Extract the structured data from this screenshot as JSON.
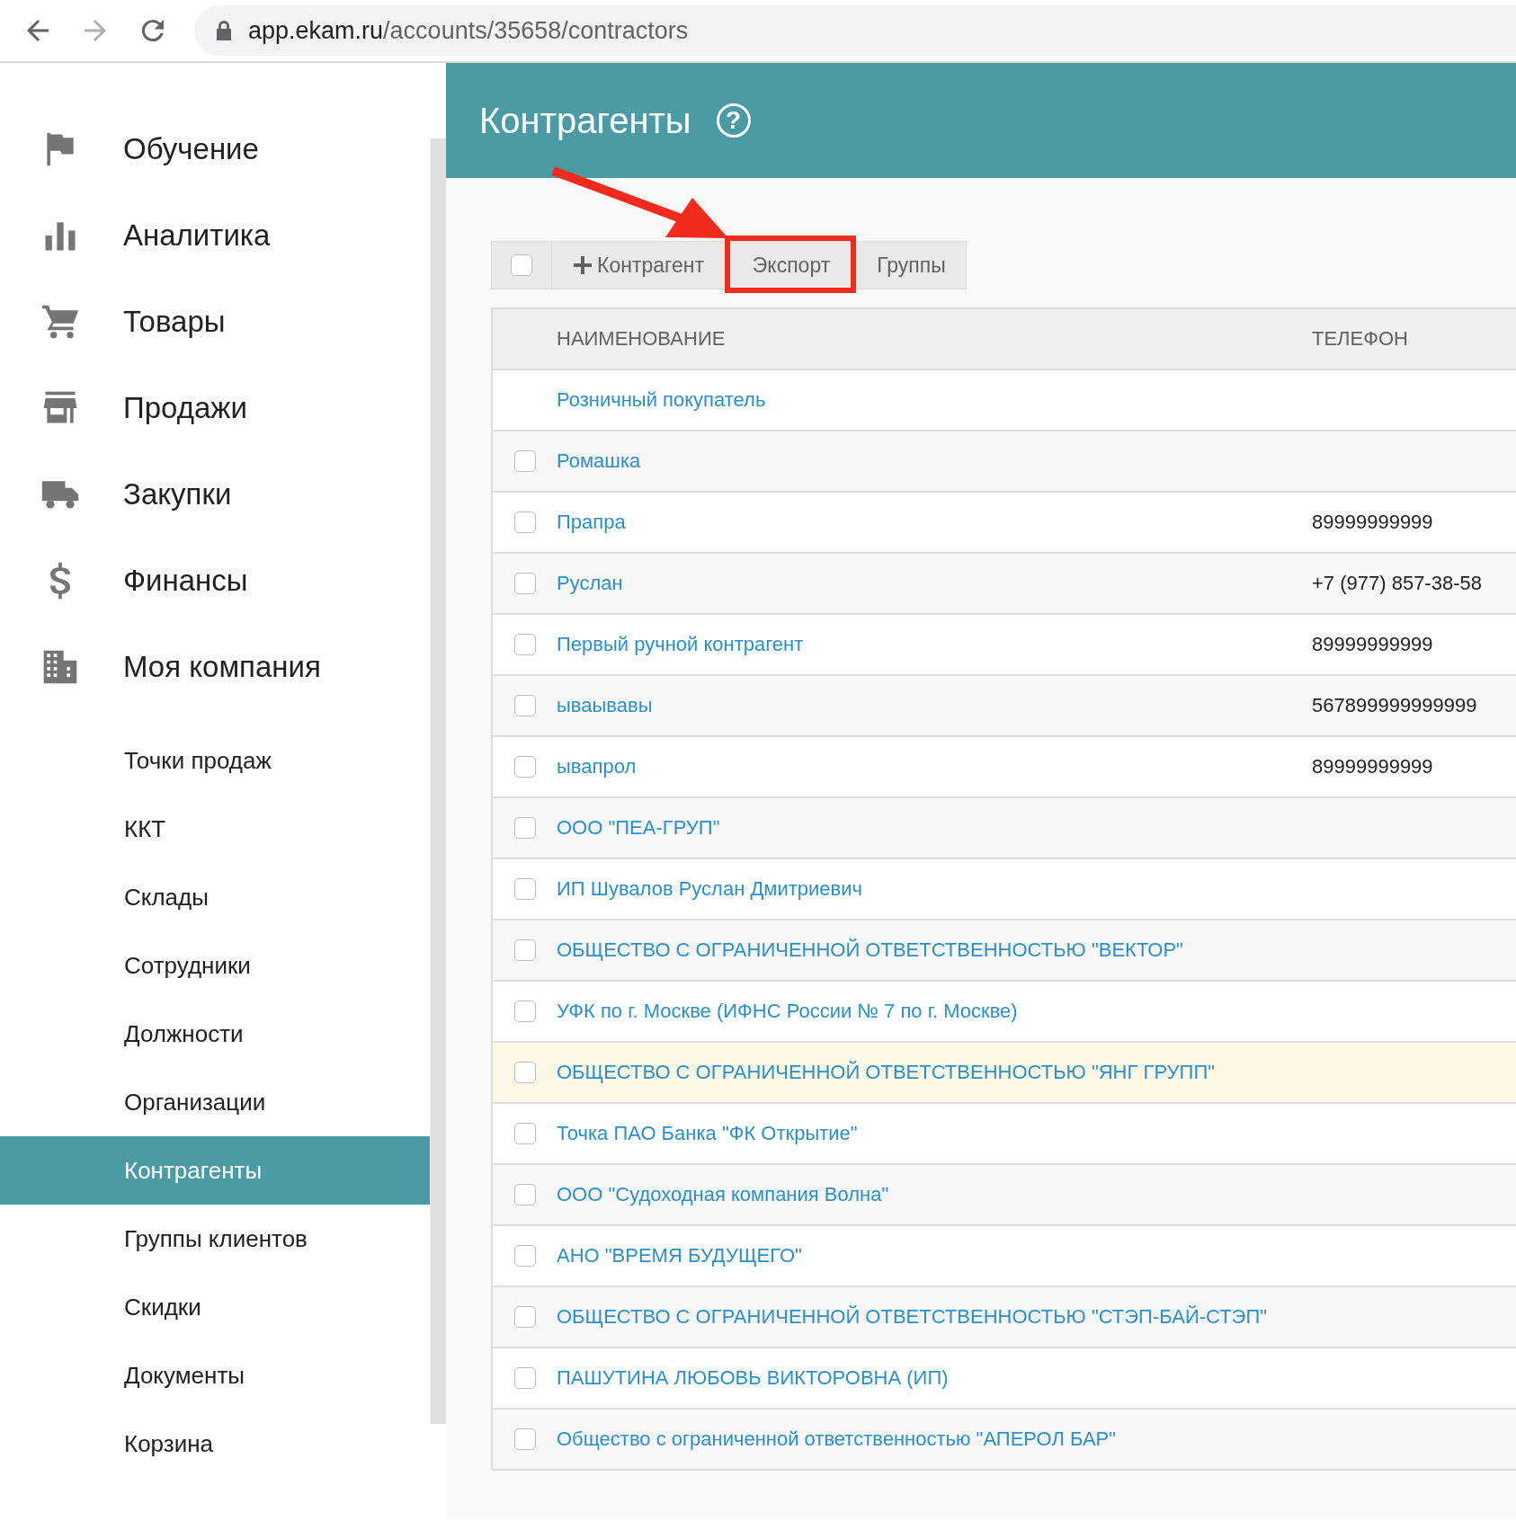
{
  "browser": {
    "url_host": "app.ekam.ru",
    "url_path": "/accounts/35658/contractors"
  },
  "sidebar": {
    "items": [
      {
        "label": "Обучение"
      },
      {
        "label": "Аналитика"
      },
      {
        "label": "Товары"
      },
      {
        "label": "Продажи"
      },
      {
        "label": "Закупки"
      },
      {
        "label": "Финансы"
      },
      {
        "label": "Моя компания"
      }
    ],
    "sub_items": [
      {
        "label": "Точки продаж",
        "selected": false
      },
      {
        "label": "ККТ",
        "selected": false
      },
      {
        "label": "Склады",
        "selected": false
      },
      {
        "label": "Сотрудники",
        "selected": false
      },
      {
        "label": "Должности",
        "selected": false
      },
      {
        "label": "Организации",
        "selected": false
      },
      {
        "label": "Контрагенты",
        "selected": true
      },
      {
        "label": "Группы клиентов",
        "selected": false
      },
      {
        "label": "Скидки",
        "selected": false
      },
      {
        "label": "Документы",
        "selected": false
      },
      {
        "label": "Корзина",
        "selected": false
      }
    ]
  },
  "header": {
    "title": "Контрагенты",
    "help": "?"
  },
  "toolbar": {
    "select_all": false,
    "buttons": [
      {
        "label": "Контрагент",
        "kind": "add"
      },
      {
        "label": "Экспорт",
        "kind": "plain"
      },
      {
        "label": "Группы",
        "kind": "plain"
      }
    ]
  },
  "table": {
    "columns": [
      "НАИМЕНОВАНИЕ",
      "ТЕЛЕФОН"
    ],
    "rows": [
      {
        "name": "Розничный покупатель",
        "highlighted": false
      },
      {
        "name": "Ромашка",
        "checked": false,
        "highlighted": false
      },
      {
        "name": "Прапра",
        "phone": "89999999999",
        "checked": false,
        "highlighted": false
      },
      {
        "name": "Руслан",
        "phone": "+7 (977) 857-38-58",
        "checked": false,
        "highlighted": false
      },
      {
        "name": "Первый ручной контрагент",
        "phone": "89999999999",
        "checked": false,
        "highlighted": false
      },
      {
        "name": "ываывавы",
        "phone": "567899999999999",
        "checked": false,
        "highlighted": false
      },
      {
        "name": "ывапрол",
        "phone": "89999999999",
        "checked": false,
        "highlighted": false
      },
      {
        "name": "ООО \"ПЕА-ГРУП\"",
        "checked": false,
        "highlighted": false
      },
      {
        "name": "ИП Шувалов Руслан Дмитриевич",
        "checked": false,
        "highlighted": false
      },
      {
        "name": "ОБЩЕСТВО С ОГРАНИЧЕННОЙ ОТВЕТСТВЕННОСТЬЮ \"ВЕКТОР\"",
        "checked": false,
        "highlighted": false
      },
      {
        "name": "УФК по г. Москве (ИФНС России № 7 по г. Москве)",
        "checked": false,
        "highlighted": false
      },
      {
        "name": "ОБЩЕСТВО С ОГРАНИЧЕННОЙ ОТВЕТСТВЕННОСТЬЮ \"ЯНГ ГРУПП\"",
        "checked": false,
        "highlighted": true
      },
      {
        "name": "Точка ПАО Банка \"ФК Открытие\"",
        "checked": false,
        "highlighted": false
      },
      {
        "name": "ООО \"Судоходная компания Волна\"",
        "checked": false,
        "highlighted": false
      },
      {
        "name": "АНО \"ВРЕМЯ БУДУЩЕГО\"",
        "checked": false,
        "highlighted": false
      },
      {
        "name": "ОБЩЕСТВО С ОГРАНИЧЕННОЙ ОТВЕТСТВЕННОСТЬЮ \"СТЭП-БАЙ-СТЭП\"",
        "checked": false,
        "highlighted": false
      },
      {
        "name": "ПАШУТИНА ЛЮБОВЬ ВИКТОРОВНА (ИП)",
        "checked": false,
        "highlighted": false
      },
      {
        "name": "Общество с ограниченной ответственностью \"АПЕРОЛ БАР\"",
        "checked": false,
        "highlighted": false
      }
    ]
  }
}
